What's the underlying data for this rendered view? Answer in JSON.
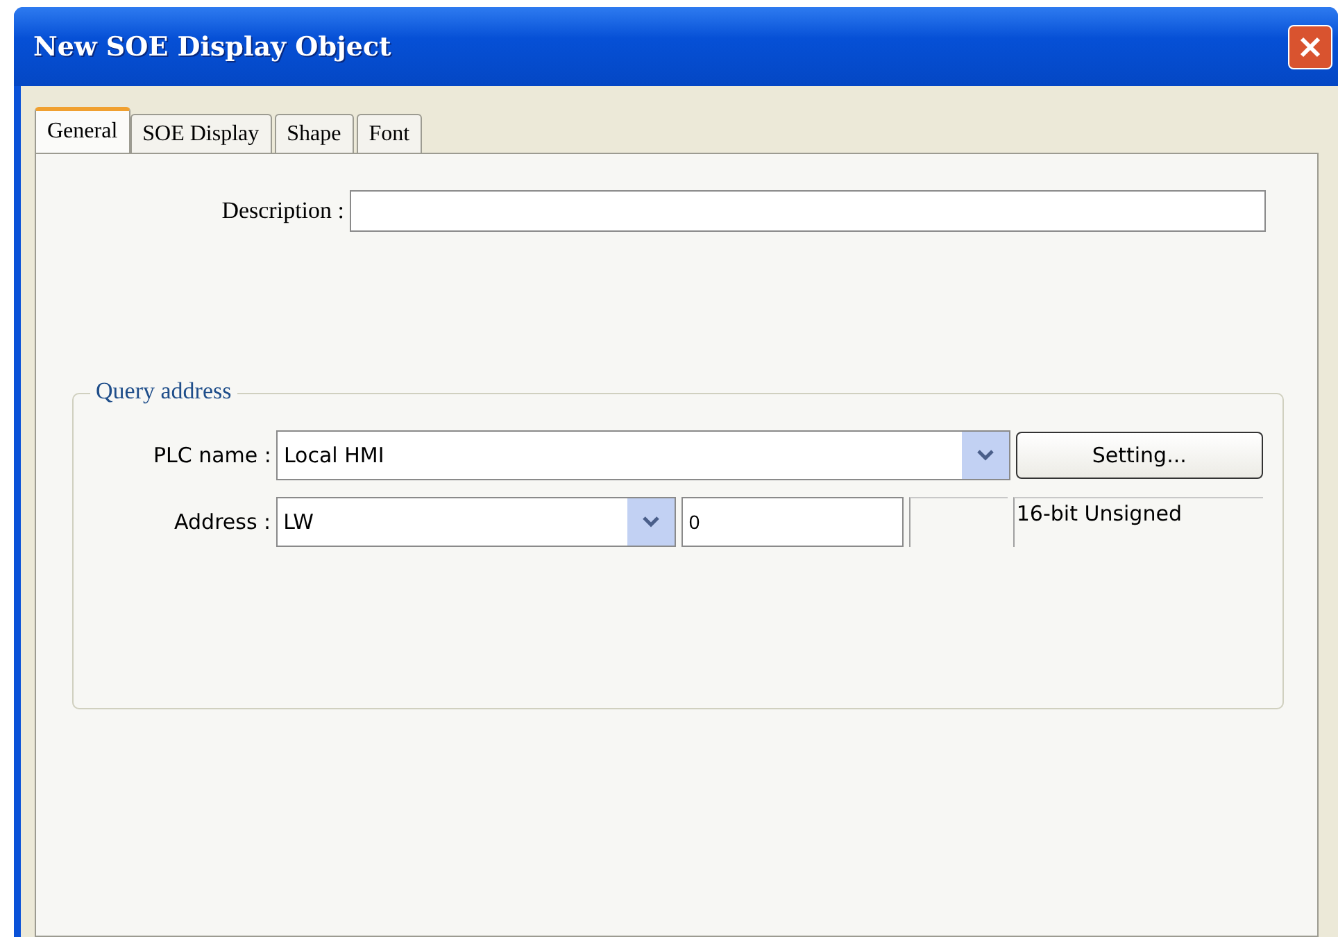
{
  "window": {
    "title": "New  SOE Display Object"
  },
  "tabs": [
    {
      "label": "General",
      "selected": true
    },
    {
      "label": "SOE Display",
      "selected": false
    },
    {
      "label": "Shape",
      "selected": false
    },
    {
      "label": "Font",
      "selected": false
    }
  ],
  "description": {
    "label": "Description :"
  },
  "query_address": {
    "legend": "Query address",
    "plc_name": {
      "label": "PLC name :",
      "value": "Local HMI"
    },
    "setting_button": "Setting...",
    "address": {
      "label": "Address :",
      "device": "LW",
      "number": "0",
      "data_format": "16-bit Unsigned"
    }
  }
}
